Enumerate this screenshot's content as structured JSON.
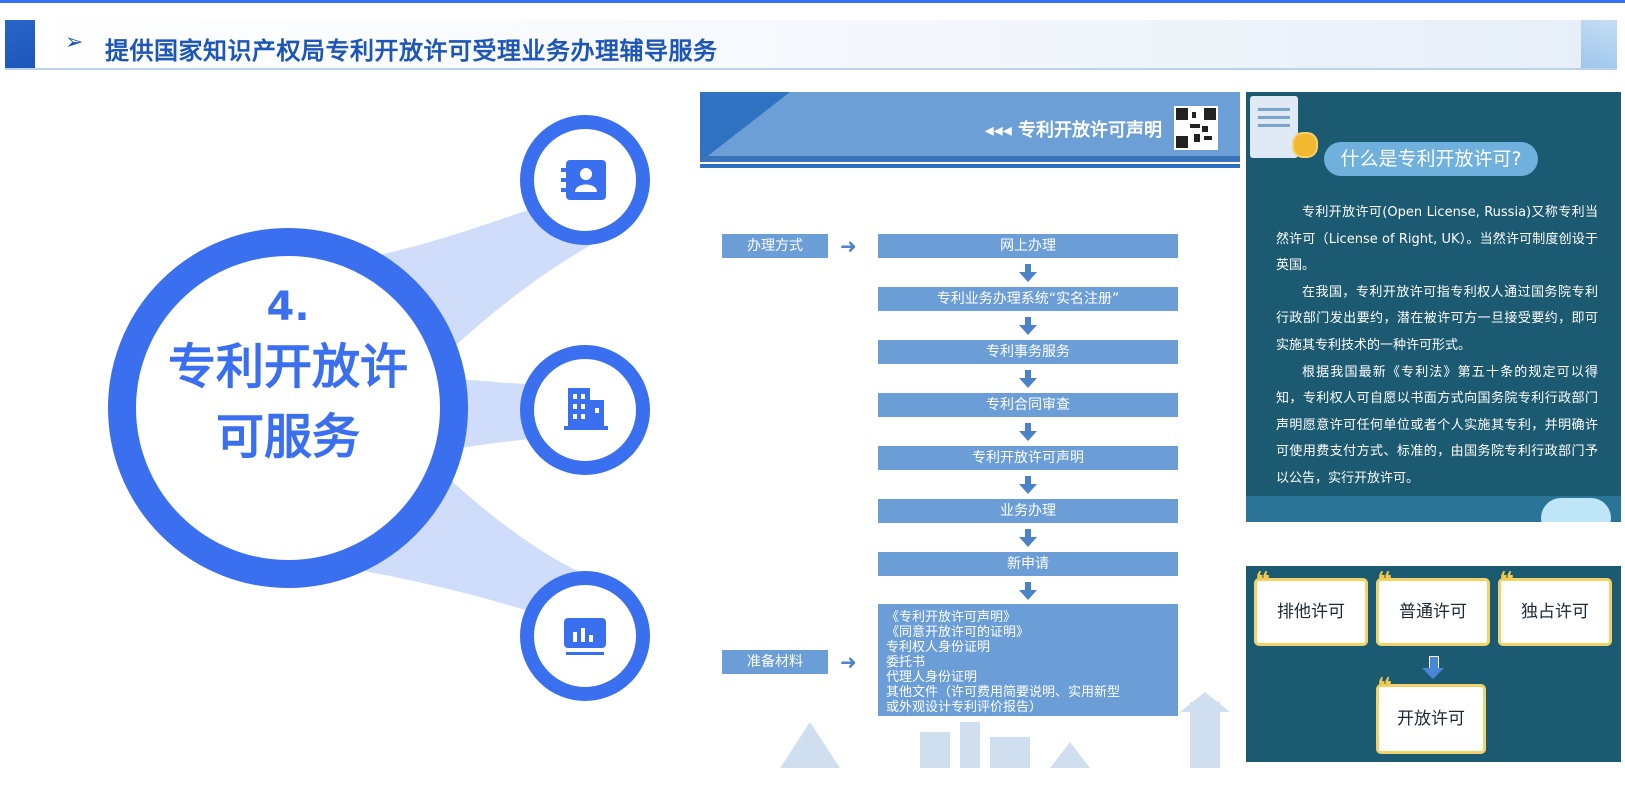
{
  "header": {
    "bullet": "➢",
    "title": "提供国家知识产权局专利开放许可受理业务办理辅导服务"
  },
  "hub": {
    "number": "4.",
    "title_line1": "专利开放许",
    "title_line2": "可服务",
    "nodes": [
      {
        "icon": "contact-book-icon"
      },
      {
        "icon": "office-building-icon"
      },
      {
        "icon": "chart-board-icon"
      }
    ],
    "colors": {
      "ring": "#3a6ff0",
      "connector": "#cfdcfa"
    }
  },
  "flowchart": {
    "banner_title": "◂◂◂ 专利开放许可声明",
    "method_label": "办理方式",
    "steps": [
      "网上办理",
      "专利业务办理系统“实名注册”",
      "专利事务服务",
      "专利合同审查",
      "专利开放许可声明",
      "业务办理",
      "新申请"
    ],
    "materials_label": "准备材料",
    "materials": [
      "《专利开放许可声明》",
      "《同意开放许可的证明》",
      "专利权人身份证明",
      "委托书",
      "代理人身份证明",
      "其他文件（许可费用简要说明、实用新型",
      "或外观设计专利评价报告）"
    ]
  },
  "info_panel": {
    "heading": "什么是专利开放许可?",
    "paragraphs": [
      "专利开放许可(Open License, Russia)又称专利当然许可（License of Right, UK）。当然许可制度创设于英国。",
      "在我国，专利开放许可指专利权人通过国务院专利行政部门发出要约，潜在被许可方一旦接受要约，即可实施其专利技术的一种许可形式。",
      "根据我国最新《专利法》第五十条的规定可以得知，专利权人可自愿以书面方式向国务院专利行政部门声明愿意许可任何单位或者个人实施其专利，并明确许可使用费支付方式、标准的，由国务院专利行政部门予以公告，实行开放许可。"
    ]
  },
  "licence_types": {
    "quote_mark": "❝",
    "cards": [
      "排他许可",
      "普通许可",
      "独占许可"
    ],
    "result": "开放许可"
  }
}
